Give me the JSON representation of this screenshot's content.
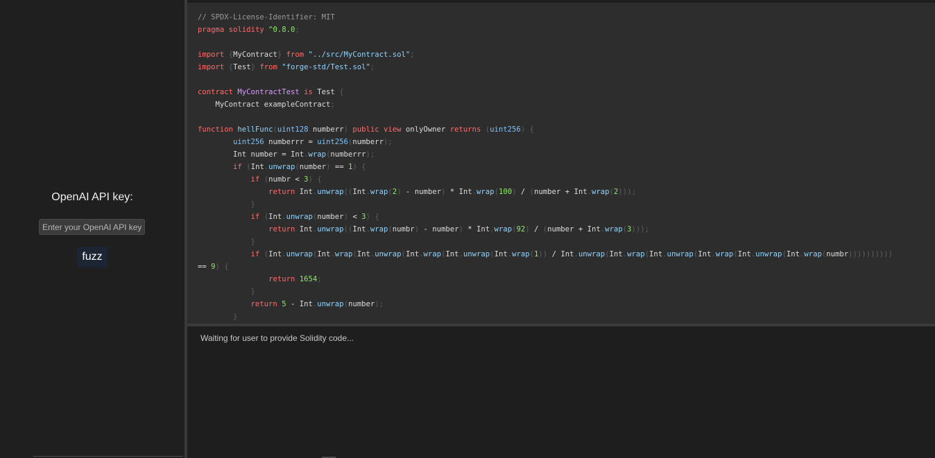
{
  "sidebar": {
    "api_key_label": "OpenAI API key:",
    "api_key_input": {
      "value": "",
      "placeholder": "Enter your OpenAI API key..."
    },
    "fuzz_button_label": "fuzz"
  },
  "editor": {
    "lines": [
      "// SPDX-License-Identifier: MIT",
      "pragma solidity ^0.8.0;",
      "",
      "import {MyContract} from \"../src/MyContract.sol\";",
      "import {Test} from \"forge-std/Test.sol\";",
      "",
      "contract MyContractTest is Test {",
      "    MyContract exampleContract;",
      "",
      "function hellFunc(uint128 numberr) public view onlyOwner returns (uint256) {",
      "        uint256 numberrr = uint256(numberr);",
      "        Int number = Int.wrap(numberrr);",
      "        if (Int.unwrap(number) == 1) {",
      "            if (numbr < 3) {",
      "                return Int.unwrap((Int.wrap(2) - number) * Int.wrap(100) / (number + Int.wrap(2)));",
      "            }",
      "            if (Int.unwrap(number) < 3) {",
      "                return Int.unwrap((Int.wrap(numbr) - number) * Int.wrap(92) / (number + Int.wrap(3)));",
      "            }",
      "            if (Int.unwrap(Int.wrap(Int.unwrap(Int.wrap(Int.unwrap(Int.wrap(1)) / Int.unwrap(Int.wrap(Int.unwrap(Int.wrap(Int.unwrap(Int.wrap(numbr))))))))))",
      "== 9) {",
      "                return 1654;",
      "            }",
      "            return 5 - Int.unwrap(number);",
      "        }"
    ]
  },
  "output": {
    "status_text": "Waiting for user to provide Solidity code..."
  },
  "colors": {
    "background": "#1e1e1e",
    "editor_background": "#2d2d2d",
    "keyword": "#ff6b6b",
    "string": "#8fd4ff",
    "number": "#8eea6b",
    "type": "#7cc4ff",
    "contract_name": "#d79cff",
    "comment": "#999999",
    "fuzz_button": "#1c2533"
  }
}
